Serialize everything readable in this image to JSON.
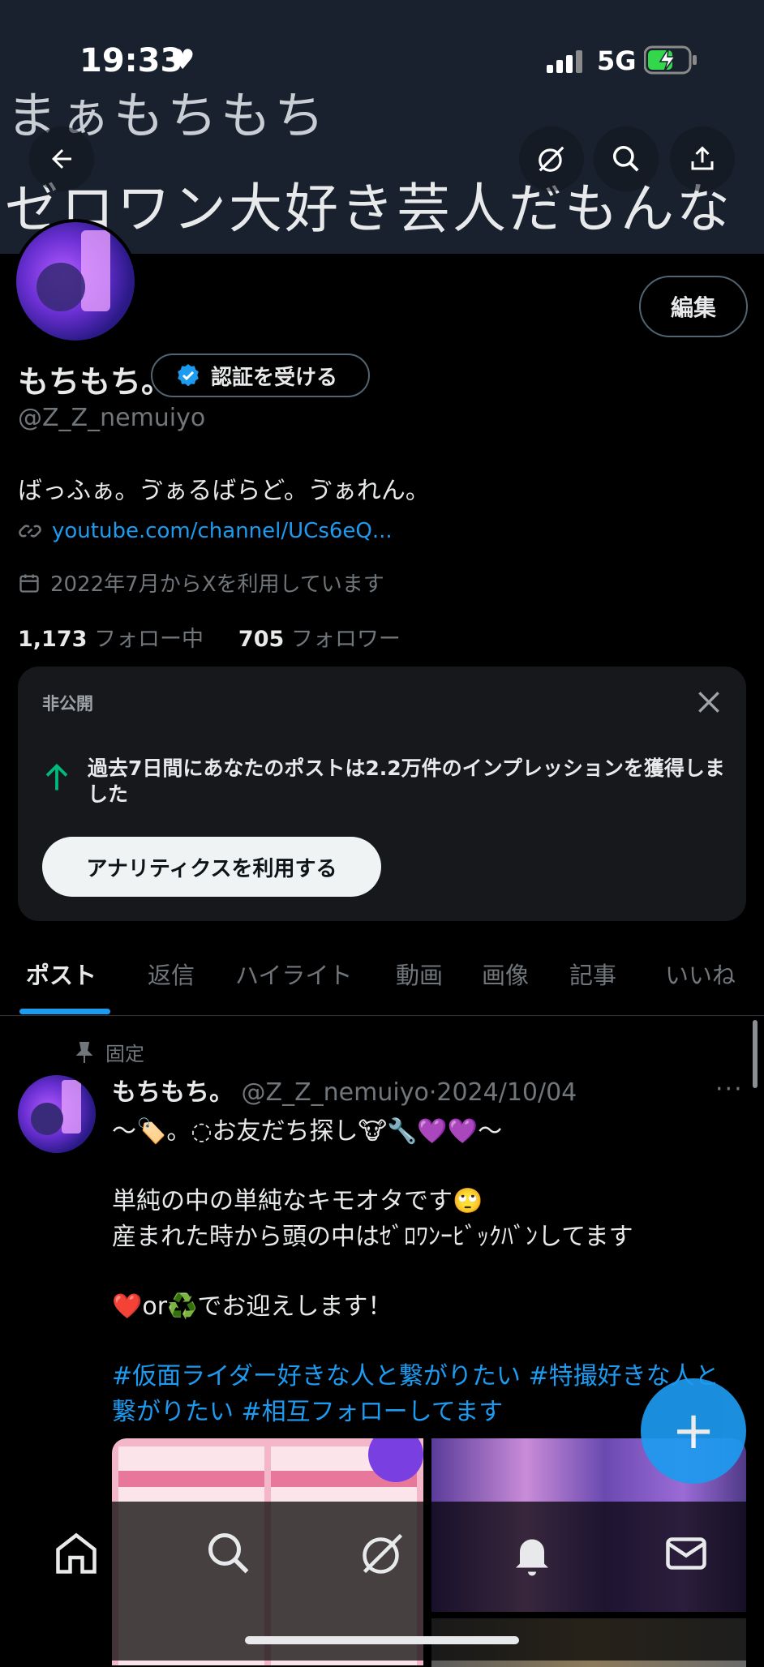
{
  "status_bar": {
    "time": "19:33",
    "network": "5G"
  },
  "banner": {
    "line1": "まぁもちもち",
    "line2": "ゼロワン大好き芸人だもんな"
  },
  "header_buttons": [
    "back-icon",
    "grok-icon",
    "search-icon",
    "share-icon"
  ],
  "profile": {
    "edit_label": "編集",
    "display_name": "もちもち。",
    "verify_label": "認証を受ける",
    "handle": "@Z_Z_nemuiyo",
    "bio": "ばっふぁ。ゔぁるばらど。ゔぁれん。",
    "link": "youtube.com/channel/UCs6eQ...",
    "joined": "2022年7月からXを利用しています",
    "following_count": "1,173",
    "following_label": "フォロー中",
    "followers_count": "705",
    "followers_label": "フォロワー"
  },
  "analytics_card": {
    "private_label": "非公開",
    "message": "過去7日間にあなたのポストは2.2万件のインプレッションを獲得しました",
    "button_label": "アナリティクスを利用する"
  },
  "tabs": [
    "ポスト",
    "返信",
    "ハイライト",
    "動画",
    "画像",
    "記事",
    "いいね"
  ],
  "active_tab": "ポスト",
  "pinned_post": {
    "pinned_label": "固定",
    "author": "もちもち。",
    "handle": "@Z_Z_nemuiyo",
    "date": "2024/10/04",
    "line1": "〜🏷️。◌お友だち探し🐮🔧💜💜〜",
    "line2": "単純の中の単純なキモオタです🙄",
    "line3": "産まれた時から頭の中はｾﾞﾛﾜﾝｰﾋﾞｯｸﾊﾞﾝしてます",
    "line4": "❤️or♻️でお迎えします！",
    "hashtags": "#仮面ライダー好きな人と繋がりたい #特撮好きな人と繋がりたい #相互フォローしてます"
  },
  "bottom_nav": [
    "home-icon",
    "search-icon",
    "grok-icon",
    "notifications-icon",
    "messages-icon"
  ],
  "colors": {
    "accent": "#1d9bf0",
    "background": "#000000",
    "secondary_text": "#71767b"
  }
}
